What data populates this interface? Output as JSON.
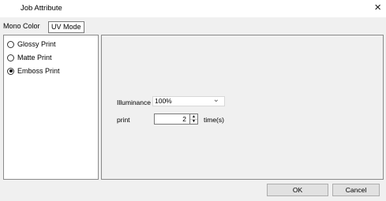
{
  "window": {
    "title": "Job Attribute",
    "close": "×"
  },
  "tabs": [
    {
      "label": "Mono Color",
      "selected": false
    },
    {
      "label": "UV Mode",
      "selected": true
    }
  ],
  "print_modes": [
    {
      "label": "Glossy Print",
      "checked": false
    },
    {
      "label": "Matte Print",
      "checked": false
    },
    {
      "label": "Emboss Print",
      "checked": true
    }
  ],
  "settings": {
    "illuminance_label": "Illuminance",
    "illuminance_value": "100%",
    "print_label": "print",
    "print_value": "2",
    "print_unit": "time(s)"
  },
  "buttons": {
    "ok": "OK",
    "cancel": "Cancel"
  },
  "icons": {
    "close": "close-icon",
    "dropdown": "chevron-down-icon",
    "spin_up": "arrow-up-icon",
    "spin_down": "arrow-down-icon"
  }
}
